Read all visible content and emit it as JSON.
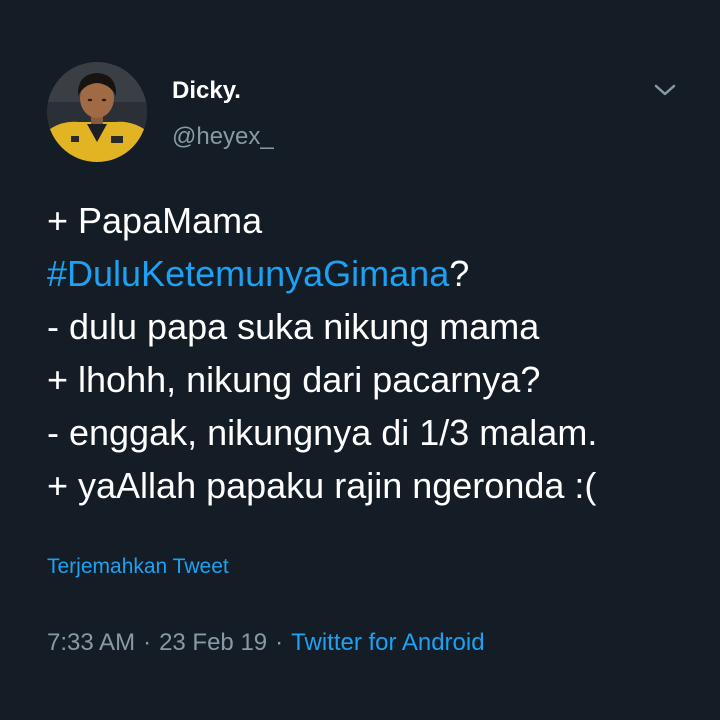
{
  "tweet": {
    "author": {
      "display_name": "Dicky.",
      "handle": "@heyex_",
      "avatar_icon": "user-avatar-photo"
    },
    "menu_icon": "chevron-down-icon",
    "body": {
      "line1": "+ PapaMama",
      "hashtag": "#DuluKetemunyaGimana",
      "hashtag_suffix": "?",
      "line3": "- dulu papa suka nikung mama",
      "line4": "+ lhohh, nikung dari pacarnya?",
      "line5": "- enggak, nikungnya di 1/3 malam.",
      "line6": "+ yaAllah papaku rajin ngeronda :("
    },
    "translate_label": "Terjemahkan Tweet",
    "time": "7:33 AM",
    "separator": "·",
    "date": "23 Feb 19",
    "source": "Twitter for Android"
  },
  "colors": {
    "background": "#141d26",
    "text": "#ffffff",
    "muted": "#8899a6",
    "link": "#1da1f2"
  }
}
